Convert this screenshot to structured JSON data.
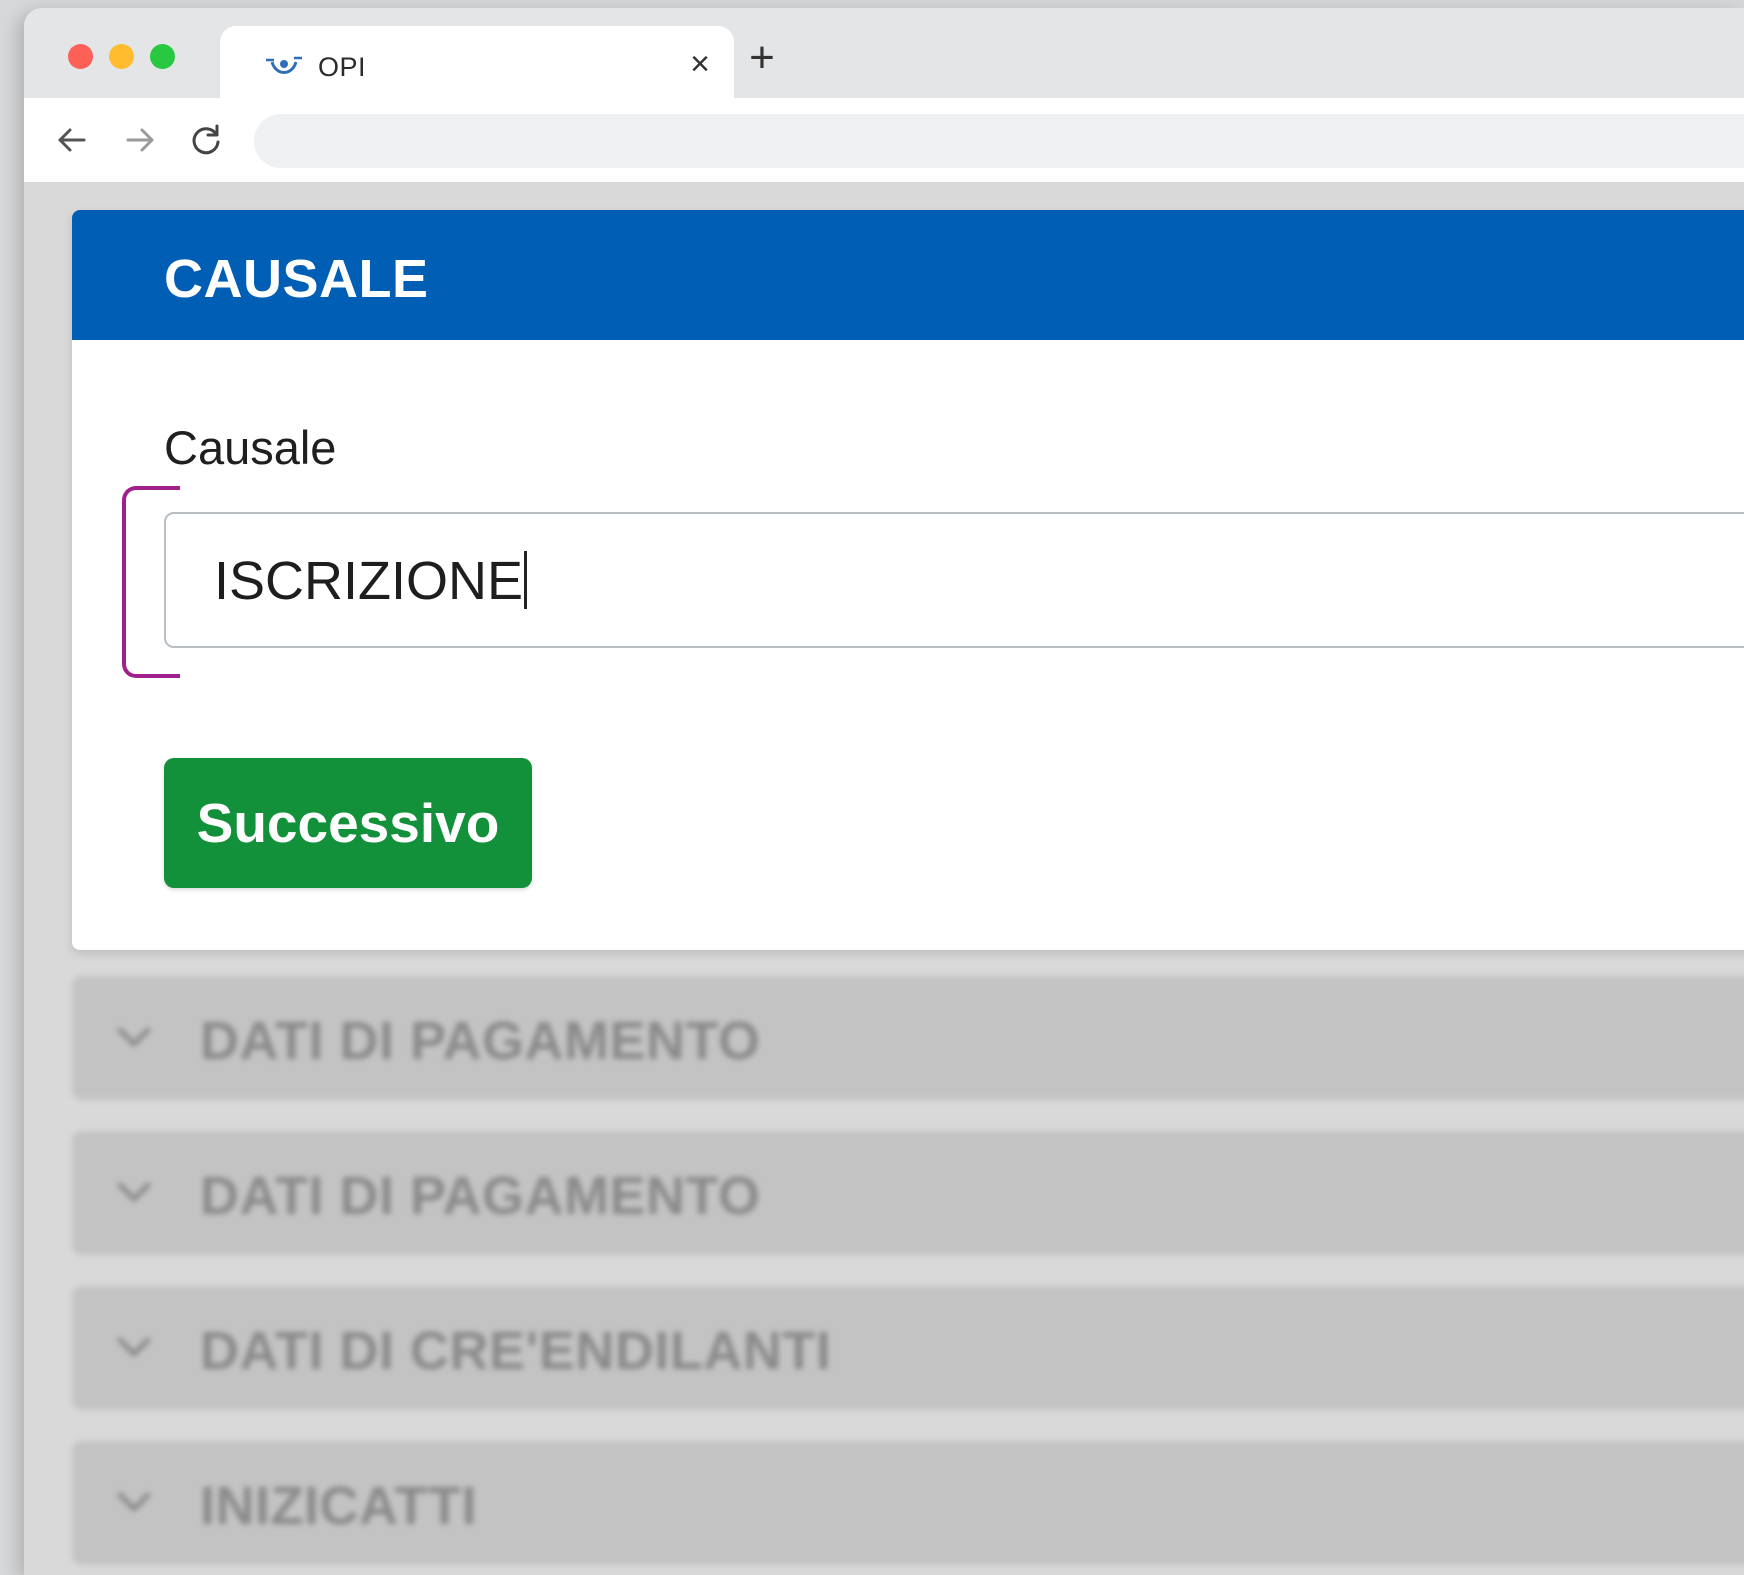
{
  "browser": {
    "tab_title": "OPI",
    "new_tab_symbol": "+",
    "close_symbol": "×",
    "address": ""
  },
  "card": {
    "title": "CAUSALE",
    "field_label": "Causale",
    "field_value": "ISCRIZIONE",
    "next_label": "Successivo"
  },
  "accordion": [
    {
      "label": "DATI DI PAGAMENTO"
    },
    {
      "label": "DATI DI PAGAMENTO"
    },
    {
      "label": "DATI DI CRE'ENDILANTI"
    },
    {
      "label": "INIZICATTI"
    }
  ],
  "colors": {
    "header_blue": "#005eb5",
    "button_green": "#12913a",
    "bracket_magenta": "#a2208d"
  },
  "icons": {
    "favicon": "opi-logo-icon",
    "back": "arrow-left-icon",
    "forward": "arrow-right-icon",
    "reload": "reload-icon",
    "accordion": "chevron-down-icon"
  }
}
